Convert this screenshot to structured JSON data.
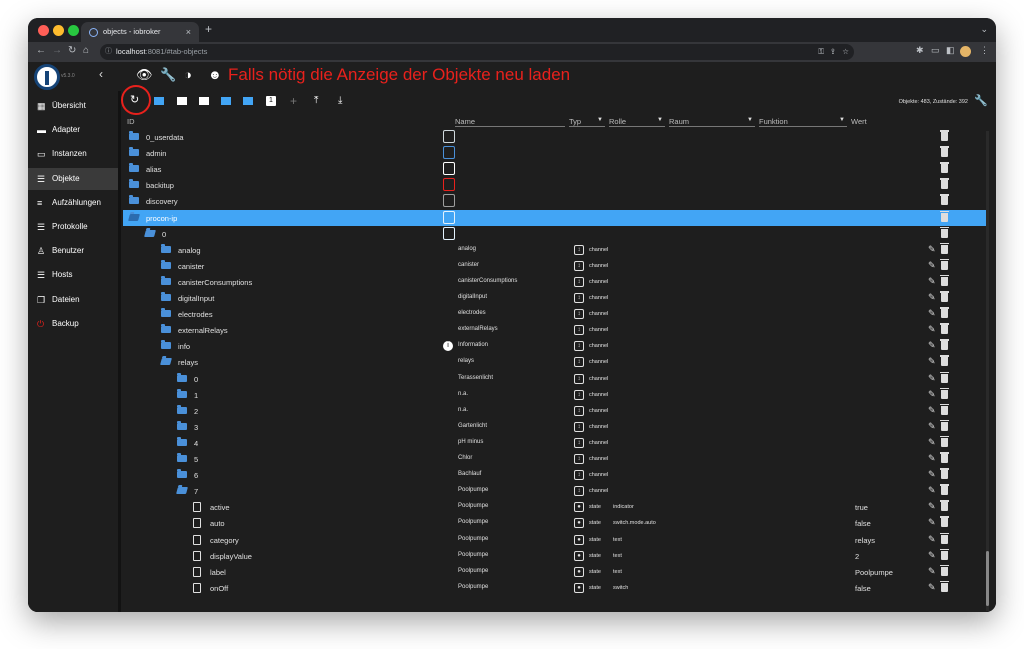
{
  "browser": {
    "tab_title": "objects - iobroker",
    "tab_close": "×",
    "new_tab": "+",
    "url_host": "localhost",
    "url_rest": ":8081/#tab-objects"
  },
  "app": {
    "version": "v5.3.0",
    "annotation": "Falls nötig die Anzeige der Objekte neu laden"
  },
  "sidebar": {
    "items": [
      {
        "label": "Übersicht",
        "icon": "grid-icon"
      },
      {
        "label": "Adapter",
        "icon": "store-icon"
      },
      {
        "label": "Instanzen",
        "icon": "instances-icon"
      },
      {
        "label": "Objekte",
        "icon": "list-icon"
      },
      {
        "label": "Aufzählungen",
        "icon": "enum-icon"
      },
      {
        "label": "Protokolle",
        "icon": "log-icon"
      },
      {
        "label": "Benutzer",
        "icon": "user-icon"
      },
      {
        "label": "Hosts",
        "icon": "hosts-icon"
      },
      {
        "label": "Dateien",
        "icon": "files-icon"
      },
      {
        "label": "Backup",
        "icon": "backup-icon"
      }
    ]
  },
  "toolbar": {
    "counts": "Objekte: 483, Zustände: 392",
    "num_badge": "1"
  },
  "columns": {
    "id": "ID",
    "name": "Name",
    "type": "Typ",
    "role": "Rolle",
    "room": "Raum",
    "function": "Funktion",
    "value": "Wert"
  },
  "colors": {
    "accent": "#42a5f5",
    "annotation": "#e8211c",
    "folder": "#4a90d9"
  },
  "rows": [
    {
      "id": "0_userdata",
      "kind": "folder",
      "level": 0
    },
    {
      "id": "admin",
      "kind": "folder",
      "level": 0
    },
    {
      "id": "alias",
      "kind": "folder",
      "level": 0
    },
    {
      "id": "backitup",
      "kind": "folder",
      "level": 0
    },
    {
      "id": "discovery",
      "kind": "folder",
      "level": 0
    },
    {
      "id": "procon-ip",
      "kind": "folder-open",
      "level": 0
    },
    {
      "id": "0",
      "kind": "folder-open",
      "level": 1
    },
    {
      "id": "analog",
      "kind": "folder",
      "level": 2,
      "name": "analog",
      "type": "channel"
    },
    {
      "id": "canister",
      "kind": "folder",
      "level": 2,
      "name": "canister",
      "type": "channel"
    },
    {
      "id": "canisterConsumptions",
      "kind": "folder",
      "level": 2,
      "name": "canisterConsumptions",
      "type": "channel"
    },
    {
      "id": "digitalInput",
      "kind": "folder",
      "level": 2,
      "name": "digitalInput",
      "type": "channel"
    },
    {
      "id": "electrodes",
      "kind": "folder",
      "level": 2,
      "name": "electrodes",
      "type": "channel"
    },
    {
      "id": "externalRelays",
      "kind": "folder",
      "level": 2,
      "name": "externalRelays",
      "type": "channel"
    },
    {
      "id": "info",
      "kind": "folder",
      "level": 2,
      "name": "Information",
      "type": "channel"
    },
    {
      "id": "relays",
      "kind": "folder-open",
      "level": 2,
      "name": "relays",
      "type": "channel"
    },
    {
      "id": "0",
      "kind": "folder",
      "level": 3,
      "name": "Terassenlicht",
      "type": "channel"
    },
    {
      "id": "1",
      "kind": "folder",
      "level": 3,
      "name": "n.a.",
      "type": "channel"
    },
    {
      "id": "2",
      "kind": "folder",
      "level": 3,
      "name": "n.a.",
      "type": "channel"
    },
    {
      "id": "3",
      "kind": "folder",
      "level": 3,
      "name": "Gartenlicht",
      "type": "channel"
    },
    {
      "id": "4",
      "kind": "folder",
      "level": 3,
      "name": "pH minus",
      "type": "channel"
    },
    {
      "id": "5",
      "kind": "folder",
      "level": 3,
      "name": "Chlor",
      "type": "channel"
    },
    {
      "id": "6",
      "kind": "folder",
      "level": 3,
      "name": "Bachlauf",
      "type": "channel"
    },
    {
      "id": "7",
      "kind": "folder-open",
      "level": 3,
      "name": "Poolpumpe",
      "type": "channel"
    },
    {
      "id": "active",
      "kind": "file",
      "level": 4,
      "name": "Poolpumpe",
      "type": "state",
      "role": "indicator",
      "value": "true"
    },
    {
      "id": "auto",
      "kind": "file",
      "level": 4,
      "name": "Poolpumpe",
      "type": "state",
      "role": "switch.mode.auto",
      "value": "false"
    },
    {
      "id": "category",
      "kind": "file",
      "level": 4,
      "name": "Poolpumpe",
      "type": "state",
      "role": "text",
      "value": "relays"
    },
    {
      "id": "displayValue",
      "kind": "file",
      "level": 4,
      "name": "Poolpumpe",
      "type": "state",
      "role": "text",
      "value": "2"
    },
    {
      "id": "label",
      "kind": "file",
      "level": 4,
      "name": "Poolpumpe",
      "type": "state",
      "role": "text",
      "value": "Poolpumpe"
    },
    {
      "id": "onOff",
      "kind": "file",
      "level": 4,
      "name": "Poolpumpe",
      "type": "state",
      "role": "switch",
      "value": "false"
    }
  ]
}
